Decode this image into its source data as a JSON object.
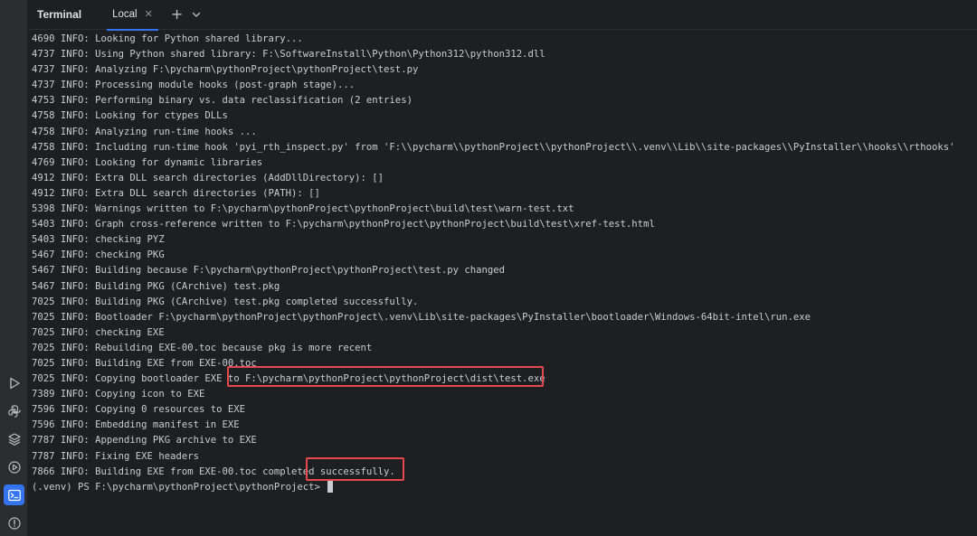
{
  "header": {
    "title": "Terminal",
    "tab_label": "Local",
    "close_glyph": "✕",
    "add_glyph": "+",
    "menu_glyph": "⌄"
  },
  "sidebar": {
    "icons": [
      "run-icon",
      "python-console-icon",
      "layers-icon",
      "services-icon",
      "terminal-icon",
      "problems-icon"
    ],
    "active": "terminal-icon"
  },
  "terminal": {
    "lines": [
      "4690 INFO: Looking for Python shared library...",
      "4737 INFO: Using Python shared library: F:\\SoftwareInstall\\Python\\Python312\\python312.dll",
      "4737 INFO: Analyzing F:\\pycharm\\pythonProject\\pythonProject\\test.py",
      "4737 INFO: Processing module hooks (post-graph stage)...",
      "4753 INFO: Performing binary vs. data reclassification (2 entries)",
      "4758 INFO: Looking for ctypes DLLs",
      "4758 INFO: Analyzing run-time hooks ...",
      "4758 INFO: Including run-time hook 'pyi_rth_inspect.py' from 'F:\\\\pycharm\\\\pythonProject\\\\pythonProject\\\\.venv\\\\Lib\\\\site-packages\\\\PyInstaller\\\\hooks\\\\rthooks'",
      "4769 INFO: Looking for dynamic libraries",
      "4912 INFO: Extra DLL search directories (AddDllDirectory): []",
      "4912 INFO: Extra DLL search directories (PATH): []",
      "5398 INFO: Warnings written to F:\\pycharm\\pythonProject\\pythonProject\\build\\test\\warn-test.txt",
      "5403 INFO: Graph cross-reference written to F:\\pycharm\\pythonProject\\pythonProject\\build\\test\\xref-test.html",
      "5403 INFO: checking PYZ",
      "5467 INFO: checking PKG",
      "5467 INFO: Building because F:\\pycharm\\pythonProject\\pythonProject\\test.py changed",
      "5467 INFO: Building PKG (CArchive) test.pkg",
      "7025 INFO: Building PKG (CArchive) test.pkg completed successfully.",
      "7025 INFO: Bootloader F:\\pycharm\\pythonProject\\pythonProject\\.venv\\Lib\\site-packages\\PyInstaller\\bootloader\\Windows-64bit-intel\\run.exe",
      "7025 INFO: checking EXE",
      "7025 INFO: Rebuilding EXE-00.toc because pkg is more recent",
      "7025 INFO: Building EXE from EXE-00.toc",
      "7025 INFO: Copying bootloader EXE to F:\\pycharm\\pythonProject\\pythonProject\\dist\\test.exe",
      "7389 INFO: Copying icon to EXE",
      "7596 INFO: Copying 0 resources to EXE",
      "7596 INFO: Embedding manifest in EXE",
      "7787 INFO: Appending PKG archive to EXE",
      "7787 INFO: Fixing EXE headers",
      "7866 INFO: Building EXE from EXE-00.toc completed successfully."
    ],
    "prompt": "(.venv) PS F:\\pycharm\\pythonProject\\pythonProject> ",
    "highlight_color": "#e5484d"
  }
}
